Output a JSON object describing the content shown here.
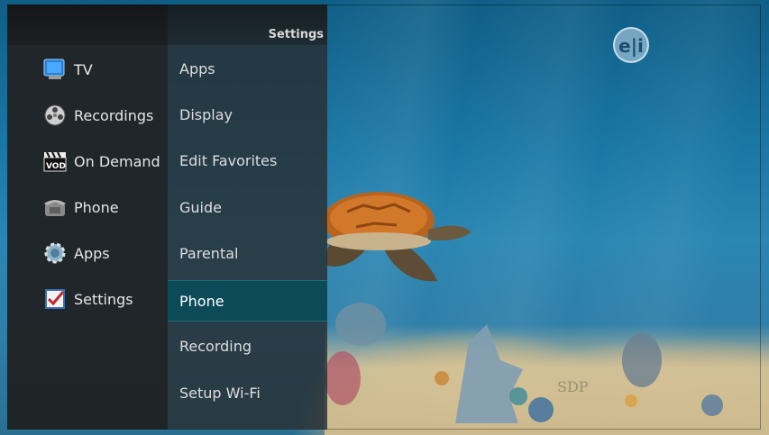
{
  "header": {
    "title": "Settings"
  },
  "nav": {
    "items": [
      {
        "label": "TV",
        "icon": "tv-icon"
      },
      {
        "label": "Recordings",
        "icon": "film-reel-icon"
      },
      {
        "label": "On Demand",
        "icon": "vod-clapperboard-icon"
      },
      {
        "label": "Phone",
        "icon": "phone-icon"
      },
      {
        "label": "Apps",
        "icon": "gear-icon"
      },
      {
        "label": "Settings",
        "icon": "checkbox-icon"
      }
    ]
  },
  "submenu": {
    "items": [
      "Apps",
      "Display",
      "Edit Favorites",
      "Guide",
      "Parental",
      "Phone",
      "Recording",
      "Setup Wi-Fi"
    ],
    "selected": "Phone"
  },
  "brand": {
    "logo_text": "e|i",
    "watermark": "SDP"
  },
  "colors": {
    "selected": "#0d4a57",
    "panel": "#222222",
    "water": "#1b78a6"
  }
}
